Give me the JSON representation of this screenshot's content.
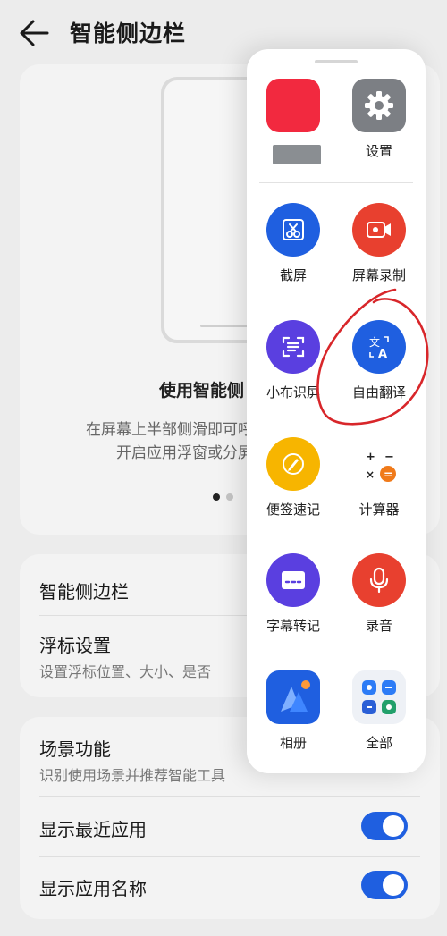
{
  "header": {
    "title": "智能侧边栏"
  },
  "preview": {
    "title": "使用智能侧",
    "desc_line1": "在屏幕上半部侧滑即可呼出",
    "desc_line2": "开启应用浮窗或分屏。"
  },
  "settings_group1": {
    "sidebar_title": "智能侧边栏",
    "float_title": "浮标设置",
    "float_sub": "设置浮标位置、大小、是否"
  },
  "settings_group2": {
    "scene_title": "场景功能",
    "scene_sub": "识别使用场景并推荐智能工具",
    "recent_title": "显示最近应用",
    "name_title": "显示应用名称",
    "recent_toggle": "on",
    "name_toggle": "on"
  },
  "sidebar_apps": [
    {
      "label": "",
      "icon": "redacted-app-icon"
    },
    {
      "label": "设置",
      "icon": "gear-icon"
    },
    {
      "label": "截屏",
      "icon": "scissors-icon"
    },
    {
      "label": "屏幕录制",
      "icon": "video-camera-icon"
    },
    {
      "label": "小布识屏",
      "icon": "scan-text-icon"
    },
    {
      "label": "自由翻译",
      "icon": "translate-icon"
    },
    {
      "label": "便签速记",
      "icon": "pen-icon"
    },
    {
      "label": "计算器",
      "icon": "calculator-icon"
    },
    {
      "label": "字幕转记",
      "icon": "subtitle-icon"
    },
    {
      "label": "录音",
      "icon": "microphone-icon"
    },
    {
      "label": "相册",
      "icon": "photo-album-icon"
    },
    {
      "label": "全部",
      "icon": "all-apps-icon"
    }
  ],
  "colors": {
    "blue": "#1f5fe0",
    "red": "#e8402f",
    "purple": "#5a3fe0",
    "yellow": "#f7b500",
    "toggle_on": "#1f5fe0",
    "annotation": "#d8262a"
  }
}
